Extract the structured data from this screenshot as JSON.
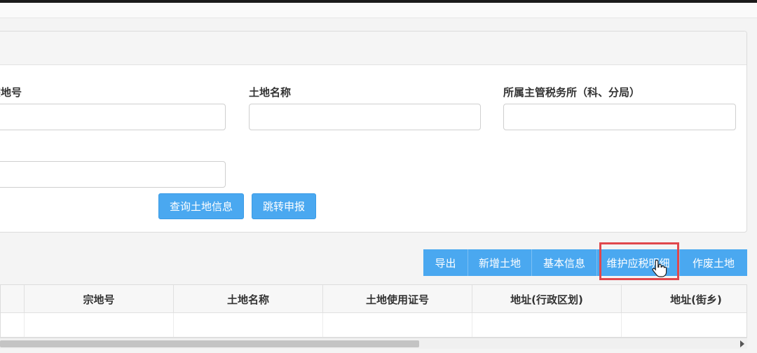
{
  "search_form": {
    "labels": {
      "land_parcel_no": "宗地号",
      "land_name": "土地名称",
      "tax_office": "所属主管税务所（科、分局）"
    },
    "values": {
      "land_parcel_no": "",
      "land_name": "",
      "tax_office": "",
      "extra": ""
    },
    "buttons": {
      "query": "查询土地信息",
      "jump_declare": "跳转申报"
    }
  },
  "toolbar": {
    "buttons": [
      {
        "label": "导出"
      },
      {
        "label": "新增土地"
      },
      {
        "label": "基本信息"
      },
      {
        "label": "维护应税明细"
      },
      {
        "label": "作废土地"
      }
    ],
    "highlight_color": "#e0474c",
    "button_color": "#4aa8f0"
  },
  "table": {
    "columns": [
      "宗地号",
      "土地名称",
      "土地使用证号",
      "地址(行政区划)",
      "地址(街乡)"
    ]
  }
}
